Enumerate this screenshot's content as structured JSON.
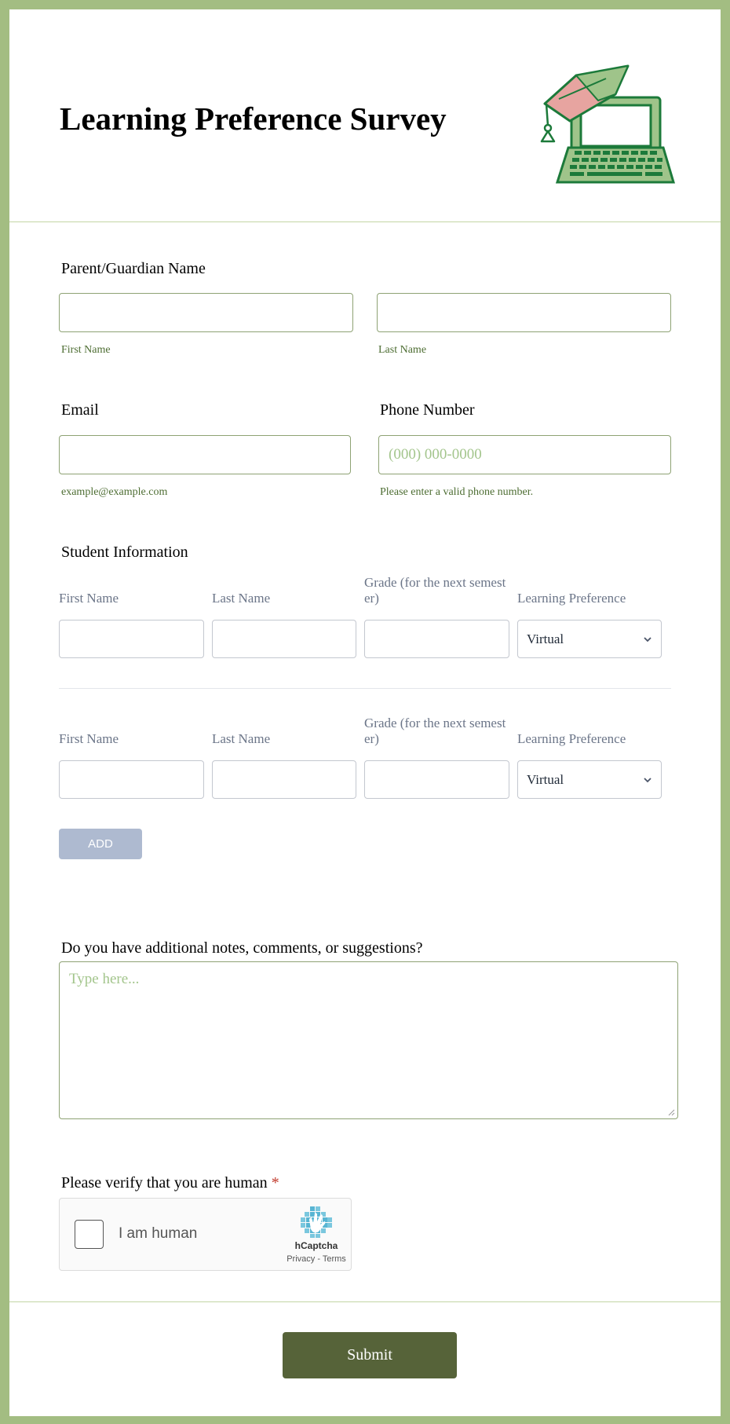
{
  "header": {
    "title": "Learning Preference Survey"
  },
  "guardian": {
    "label": "Parent/Guardian Name",
    "first_sub": "First Name",
    "last_sub": "Last Name"
  },
  "email": {
    "label": "Email",
    "sub": "example@example.com"
  },
  "phone": {
    "label": "Phone Number",
    "placeholder": "(000) 000-0000",
    "sub": "Please enter a valid phone number."
  },
  "students": {
    "label": "Student Information",
    "columns": [
      "First Name",
      "Last Name",
      "Grade (for the next semester)",
      "Learning Preference"
    ],
    "grade_col_lines": [
      "Grade (for the next semest",
      "er)"
    ],
    "rows": [
      {
        "preference": "Virtual"
      },
      {
        "preference": "Virtual"
      }
    ],
    "add_label": "ADD"
  },
  "notes": {
    "label": "Do you have additional notes, comments, or suggestions?",
    "placeholder": "Type here..."
  },
  "verify": {
    "label": "Please verify that you are human",
    "required_mark": "*"
  },
  "captcha": {
    "text": "I am human",
    "brand": "hCaptcha",
    "privacy": "Privacy",
    "sep": " - ",
    "terms": "Terms"
  },
  "submit": {
    "label": "Submit"
  },
  "colors": {
    "frame": "#a3bd82",
    "accent": "#566339",
    "sub_text": "#4d6d32",
    "add_button": "#aebad0"
  }
}
